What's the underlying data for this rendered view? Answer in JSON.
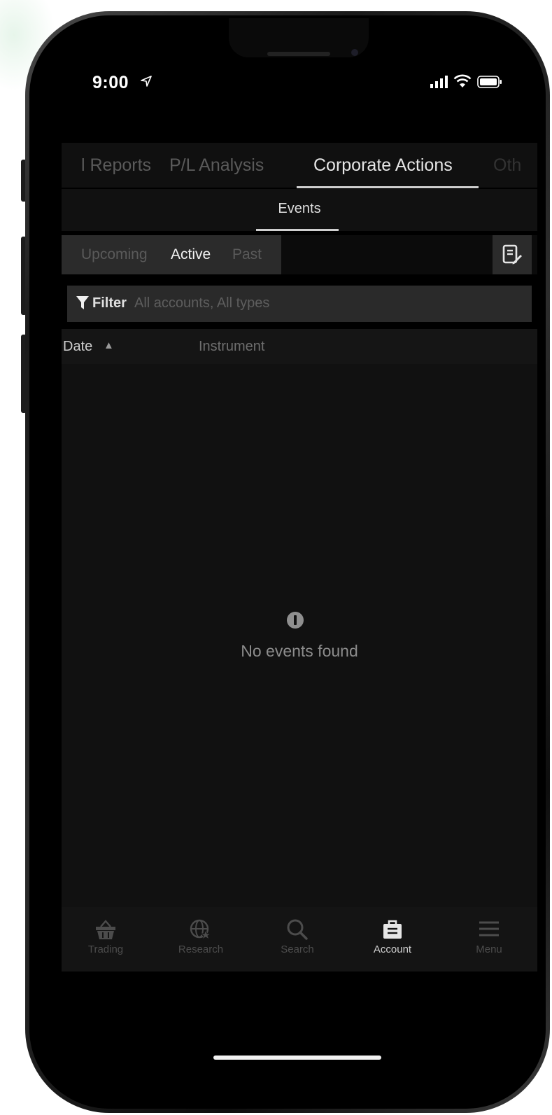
{
  "status_bar": {
    "time": "9:00"
  },
  "tabs": [
    {
      "label": "l Reports"
    },
    {
      "label": "P/L Analysis"
    },
    {
      "label": "Corporate Actions"
    },
    {
      "label": "Oth"
    }
  ],
  "subtab": {
    "label": "Events"
  },
  "segments": [
    {
      "label": "Upcoming"
    },
    {
      "label": "Active"
    },
    {
      "label": "Past"
    }
  ],
  "filter": {
    "label": "Filter",
    "value": "All accounts, All types"
  },
  "columns": {
    "date": "Date",
    "sort_arrow": "▲",
    "instrument": "Instrument"
  },
  "empty_state": {
    "message": "No events found"
  },
  "bottom_nav": [
    {
      "label": "Trading"
    },
    {
      "label": "Research"
    },
    {
      "label": "Search"
    },
    {
      "label": "Account"
    },
    {
      "label": "Menu"
    }
  ]
}
